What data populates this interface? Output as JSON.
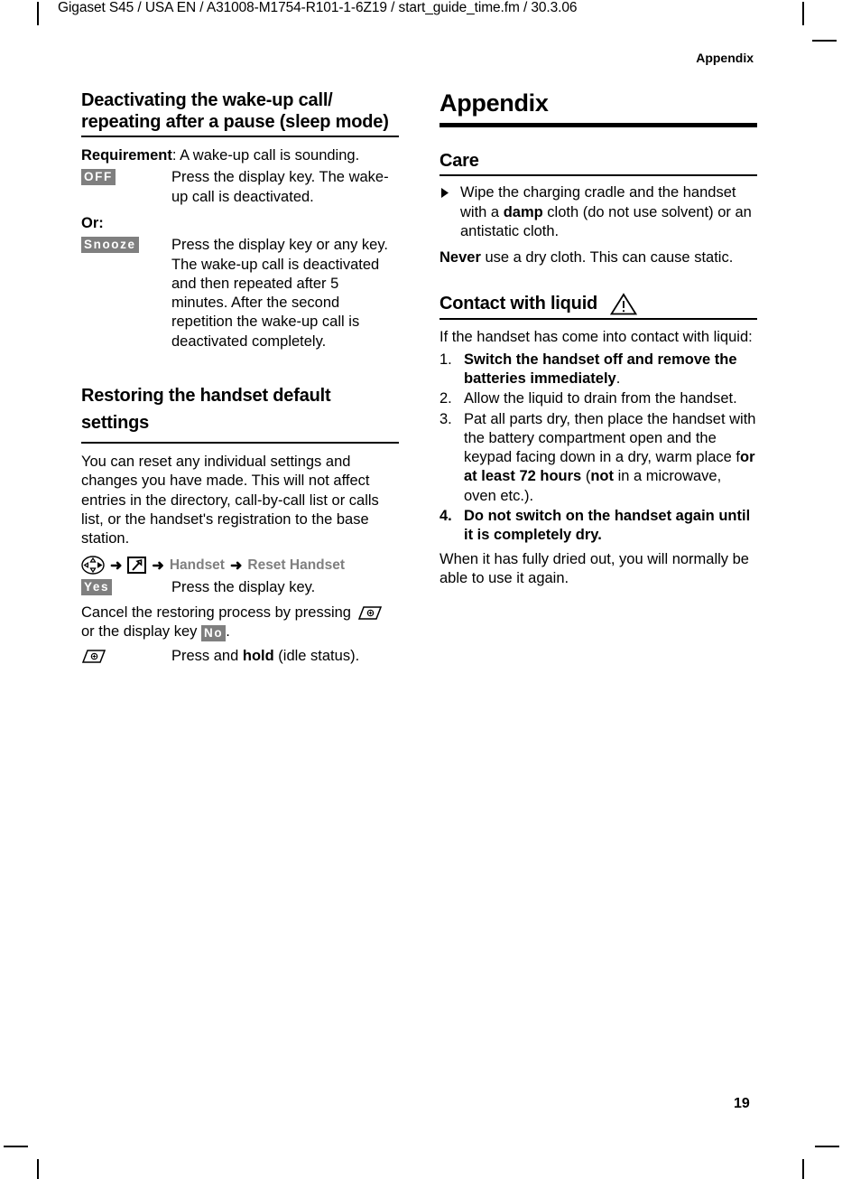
{
  "running_head": {
    "left": "Gigaset S45 / USA EN / A31008-M1754-R101-1-6Z19 / start_guide_time.fm / 30.3.06",
    "right": "Appendix"
  },
  "page_number": "19",
  "colors": {
    "softkey_background": "#7f7f7f",
    "softkey_text": "#ffffff",
    "menu_name_text": "#7f7f7f",
    "rule": "#000000",
    "page_background": "#ffffff"
  },
  "left_column": {
    "section_sleep_mode": {
      "heading": "Deactivating the wake-up call/ repeating after a pause (sleep mode)",
      "requirement_label": "Requirement",
      "requirement_text": ": A wake-up call is sounding.",
      "row_off": {
        "key": "OFF",
        "description": "Press the display key. The wake-up call is deactivated."
      },
      "or_label": "Or:",
      "row_snooze": {
        "key": "Snooze",
        "description": "Press the display key or any key. The wake-up call is deactivated and then repeated after 5 minutes. After the second repetition the wake-up call is deactivated completely."
      }
    },
    "section_restore": {
      "heading": "Restoring the handset default settings",
      "intro": "You can reset any individual settings and changes you have made. This will not affect entries in the directory, call-by-call list or calls list, or the handset's registration to the base station.",
      "menu_path": {
        "nav_icon": "navigation-key-icon",
        "arrow": "➜",
        "settings_icon": "settings-wrench-icon",
        "item_1": "Handset",
        "item_2": "Reset Handset"
      },
      "row_yes": {
        "key": "Yes",
        "description": "Press the display key."
      },
      "cancel_text_before": "Cancel the restoring process by pressing",
      "cancel_icon": "end-call-key-icon",
      "cancel_text_middle": "or the display key",
      "cancel_key": "No",
      "cancel_text_after": ".",
      "row_hold": {
        "icon": "end-call-key-icon",
        "description_before": "Press and ",
        "description_bold": "hold",
        "description_after": " (idle status)."
      }
    }
  },
  "right_column": {
    "chapter_title": "Appendix",
    "section_care": {
      "heading": "Care",
      "bullet": {
        "marker": "▶",
        "text_before": "Wipe the charging cradle and the handset with a ",
        "text_bold": "damp",
        "text_after": " cloth (do not use solvent) or an antistatic cloth."
      },
      "note_bold": "Never",
      "note_rest": " use a dry cloth. This can cause static."
    },
    "section_liquid": {
      "heading": "Contact with liquid",
      "warning_icon": "warning-triangle-icon",
      "intro": "If the handset has come into contact with liquid:",
      "steps": [
        {
          "number": "1.",
          "bold_text": "Switch the handset off and remove the batteries immediately",
          "plain_text": "."
        },
        {
          "number": "2.",
          "bold_text": "",
          "plain_text": "Allow the liquid to drain from the handset."
        },
        {
          "number": "3.",
          "plain_prefix": "Pat all parts dry, then place the handset with the battery compartment open and the keypad facing down in a dry, warm place f",
          "bold_text": "or at least 72 hours",
          "plain_middle": " (",
          "bold_text_2": "not",
          "plain_suffix": " in a microwave, oven etc.)."
        },
        {
          "number": "4.",
          "bold_text": "Do not switch on the handset again until it is completely dry.",
          "plain_text": ""
        }
      ],
      "closing": "When it has fully dried out, you will normally be able to use it again."
    }
  }
}
